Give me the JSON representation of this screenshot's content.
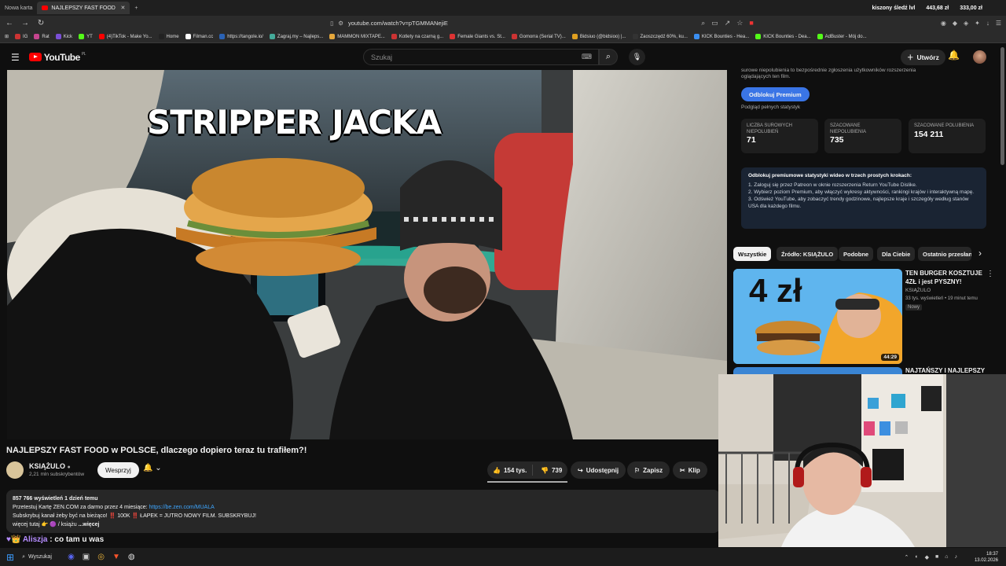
{
  "browser": {
    "tabs": [
      {
        "label": "Nowa karta"
      },
      {
        "label": "NAJLEPSZY FAST FOOD w PO"
      }
    ],
    "ticker": {
      "item1": "kiszony śledź lvl",
      "item2": "443,68 zł",
      "item3": "333,00 zł"
    },
    "url": "youtube.com/watch?v=pTGMMANejiE",
    "bookmarks": [
      "IG",
      "Rat",
      "Kick",
      "YT",
      "(4)TikTok - Make Yo...",
      "Home",
      "Filman.cc",
      "https://tangole.io/",
      "Zagraj.my – Najleps...",
      "MAMMON MIXTAPE...",
      "Kotlety na czarną g...",
      "Female Giants vs. St...",
      "Gomorra (Serial TV)...",
      "Bidsiuo (@bidsioo) |...",
      "Zaoszczędź 60%, ku...",
      "KICK Bounties - Hea...",
      "KICK Bounties - Dea...",
      "AdBuster - Mój do..."
    ]
  },
  "youtube": {
    "logo": "YouTube",
    "region": "PL",
    "search_placeholder": "Szukaj",
    "create_label": "Utwórz",
    "video_overlay_title": "STRIPPER JACKA",
    "video_title": "NAJLEPSZY FAST FOOD w POLSCE, dlaczego dopiero teraz tu trafiłem?!",
    "channel": {
      "name": "KSIĄŻULO",
      "subs": "2,21 mln subskrybentów",
      "support": "Wesprzyj"
    },
    "actions": {
      "likes": "154 tys.",
      "dislikes": "739",
      "share": "Udostępnij",
      "save": "Zapisz",
      "clip": "Klip"
    },
    "description": {
      "meta": "857 766 wyświetleń  1 dzień temu",
      "line1_text": "Przetestuj Kartę ZEN.COM za darmo przez 4 miesiące:",
      "line1_link": "https://be.zen.com/MUALA",
      "line2": "Subskrybuj kanał żeby być na bieżąco! ‼️ 100K ‼️ ŁAPEK = JUTRO NOWY FILM. SUBSKRYBUJ!",
      "line3": "więcej tutaj 👉 🟣 / książu",
      "more": "...więcej"
    },
    "chat": {
      "user": "Aliszja",
      "message": " : co tam u was"
    }
  },
  "dislike_panel": {
    "top_text": "surowe niepolubienia to bezpośrednie zgłoszenia użytkowników rozszerzenia oglądających ten film.",
    "unlock": "Odblokuj Premium",
    "full_stats": "Podgląd pełnych statystyk",
    "stats": [
      {
        "label": "LICZBA SUROWYCH NIEPOLUBIEŃ",
        "value": "71"
      },
      {
        "label": "SZACOWANE NIEPOLUBIENIA",
        "value": "735"
      },
      {
        "label": "SZACOWANE POLUBIENIA",
        "value": "154 211"
      }
    ],
    "steps_title": "Odblokuj premiumowe statystyki wideo w trzech prostych krokach:",
    "steps": [
      "1. Zaloguj się przez Patreon w oknie rozszerzenia Return YouTube Dislike.",
      "2. Wybierz poziom Premium, aby włączyć wykresy aktywności, rankingi krajów i interaktywną mapę.",
      "3. Odśwież YouTube, aby zobaczyć trendy godzinowe, najlepsze kraje i szczegóły według stanów USA dla każdego filmu."
    ]
  },
  "chips": [
    "Wszystkie",
    "Źródło: KSIĄŻULO",
    "Podobne",
    "Dla Ciebie",
    "Ostatnio przesłane"
  ],
  "recommendations": [
    {
      "title": "TEN BURGER KOSZTUJE 4ZŁ i jest PYSZNY!",
      "channel": "KSIĄŻULO",
      "meta": "33 tys. wyświetleń • 19 minut temu",
      "badge": "Nowy",
      "duration": "44:29",
      "thumb_text": "4 zł"
    },
    {
      "title": "NAJTAŃSZY I NAJLEPSZY"
    }
  ],
  "taskbar": {
    "search": "Wyszukaj",
    "time": "18:37",
    "date": "13.02.2026"
  }
}
